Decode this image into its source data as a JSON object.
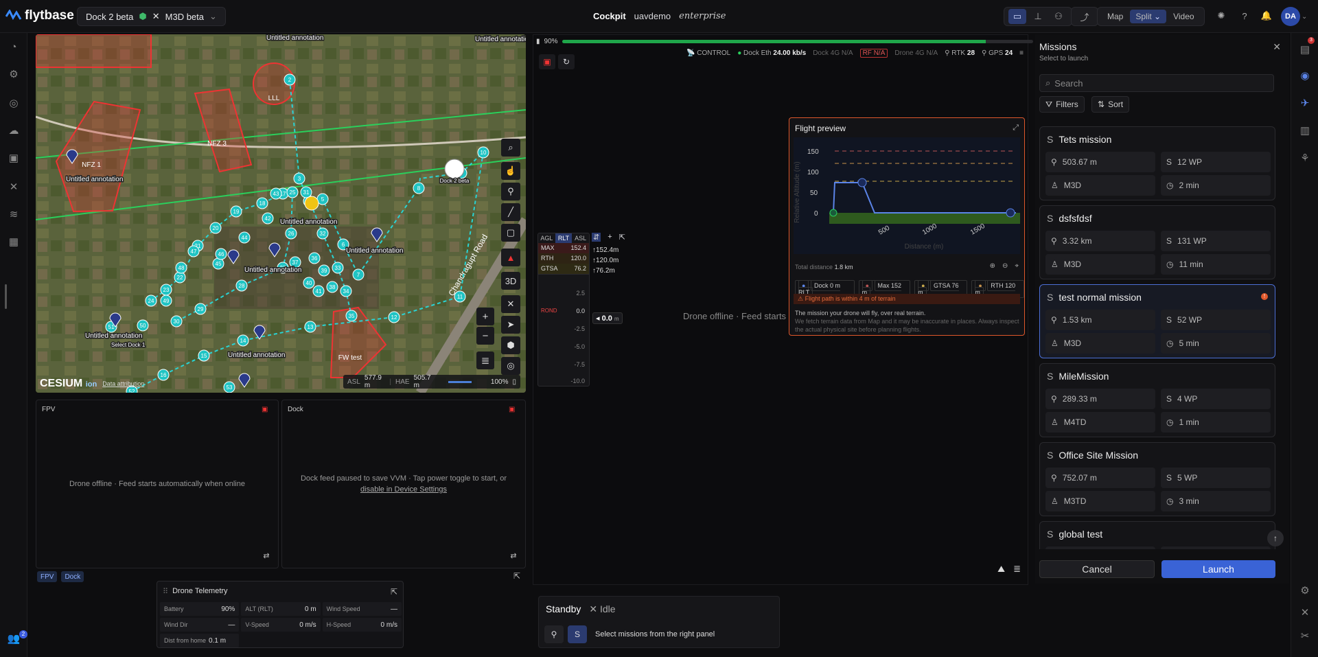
{
  "header": {
    "brand": "flytbase",
    "dock_name": "Dock 2 beta",
    "drone_name": "M3D beta",
    "title": "Cockpit",
    "org": "uavdemo",
    "tier": "enterprise",
    "views": [
      "Map",
      "Split",
      "Video"
    ],
    "active_view": "Split",
    "avatar": "DA"
  },
  "left_rail": {
    "badge": "2"
  },
  "map": {
    "annotations": [
      "Untitled annotation",
      "Untitled annotation",
      "Untitled annotation",
      "Untitled annotation",
      "Untitled annotation",
      "Untitled annotation",
      "Untitled annotation",
      "Untitled annotation",
      "Untitled annotation"
    ],
    "zones": [
      "NFZ 1",
      "NFZ 3",
      "LLL",
      "FW test"
    ],
    "road": "Chandragupt Road",
    "dock_label": "Dock 2 beta",
    "select_dock": "Select Dock 1",
    "waypoints": [
      "2",
      "3",
      "4",
      "5",
      "6",
      "7",
      "8",
      "9",
      "10",
      "11",
      "12",
      "13",
      "14",
      "15",
      "16",
      "17",
      "18",
      "19",
      "20",
      "21",
      "22",
      "23",
      "24",
      "25",
      "26",
      "27",
      "28",
      "29",
      "30",
      "31",
      "32",
      "33",
      "34",
      "35",
      "36",
      "37",
      "38",
      "39",
      "40",
      "41",
      "42",
      "43",
      "44",
      "45",
      "46",
      "47",
      "48",
      "49",
      "50",
      "51",
      "52",
      "53"
    ],
    "three_d": "3D",
    "cesium": "CESIUM",
    "ion": "ion",
    "attribution": "Data attribution",
    "asl_label": "ASL",
    "asl": "577.9 m",
    "hae_label": "HAE",
    "hae": "505.7 m",
    "zoom": "100%"
  },
  "feeds": {
    "fpv_title": "FPV",
    "fpv_msg": "Drone offline · Feed starts automatically when online",
    "dock_title": "Dock",
    "dock_msg": "Dock feed paused to save VVM · Tap power toggle to start, or",
    "dock_link": "disable in Device Settings",
    "chips": [
      "FPV",
      "Dock"
    ]
  },
  "telemetry": {
    "title": "Drone Telemetry",
    "cells": [
      {
        "label": "Battery",
        "value": "90%"
      },
      {
        "label": "ALT (RLT)",
        "value": "0 m"
      },
      {
        "label": "Wind Speed",
        "value": "—"
      },
      {
        "label": "Wind Dir",
        "value": "—"
      },
      {
        "label": "V-Speed",
        "value": "0 m/s"
      },
      {
        "label": "H-Speed",
        "value": "0 m/s"
      },
      {
        "label": "Dist from home",
        "value": "0.1 m"
      }
    ]
  },
  "status": {
    "battery": "90%",
    "battery_level": 0.9,
    "control": "CONTROL",
    "dock_eth_label": "Dock Eth",
    "dock_eth": "24.00 kb/s",
    "dock_4g": "Dock 4G",
    "na": "N/A",
    "rf": "RF",
    "drone_4g": "Drone 4G",
    "rtk_label": "RTK",
    "rtk": "28",
    "gps_label": "GPS",
    "gps": "24"
  },
  "altitude": {
    "tabs": [
      "AGL",
      "RLT",
      "ASL"
    ],
    "active": "RLT",
    "rows": [
      {
        "k": "MAX",
        "v": "152.4"
      },
      {
        "k": "RTH",
        "v": "120.0"
      },
      {
        "k": "GTSA",
        "v": "76.2"
      }
    ],
    "right": [
      "↑152.4m",
      "↑120.0m",
      "↑76.2m"
    ],
    "ticks": [
      "2.5",
      "0.0",
      "-2.5",
      "-5.0",
      "-7.5",
      "-10.0"
    ],
    "ground": "ROND",
    "current": "0.0"
  },
  "flight_preview": {
    "title": "Flight preview",
    "ylabel": "Relative Altitude (m)",
    "xlabel": "Distance (m)",
    "yticks": [
      "150",
      "100",
      "50",
      "0"
    ],
    "xticks": [
      "500",
      "1000",
      "1500"
    ],
    "total_label": "Total distance",
    "total": "1.8 km",
    "legend": [
      "Dock 0 m RLT",
      "Max 152 m",
      "GTSA 76 m",
      "RTH 120 m"
    ],
    "warning": "Flight path is within 4 m of terrain",
    "note": "The mission your drone will fly, over real terrain.",
    "note2": "We fetch terrain data from Map and it may be inaccurate in places. Always inspect the actual physical site before planning flights."
  },
  "center": {
    "offline": "Drone offline · Feed starts au",
    "standby": "Standby",
    "idle": "Idle",
    "select": "Select missions from the right panel"
  },
  "missions": {
    "title": "Missions",
    "subtitle": "Select to launch",
    "search_placeholder": "Search",
    "filters": "Filters",
    "sort": "Sort",
    "cancel": "Cancel",
    "launch": "Launch",
    "items": [
      {
        "name": "Tets mission",
        "distance": "503.67 m",
        "wp": "12 WP",
        "drone": "M3D",
        "time": "2 min"
      },
      {
        "name": "dsfsfdsf",
        "distance": "3.32 km",
        "wp": "131 WP",
        "drone": "M3D",
        "time": "11 min"
      },
      {
        "name": "test normal mission",
        "distance": "1.53 km",
        "wp": "52 WP",
        "drone": "M3D",
        "time": "5 min"
      },
      {
        "name": "MileMission",
        "distance": "289.33 m",
        "wp": "4 WP",
        "drone": "M4TD",
        "time": "1 min"
      },
      {
        "name": "Office Site Mission",
        "distance": "752.07 m",
        "wp": "5 WP",
        "drone": "M3TD",
        "time": "3 min"
      },
      {
        "name": "global test",
        "distance": "",
        "wp": "",
        "drone": "",
        "time": ""
      }
    ]
  },
  "right_rail": {
    "badge": "3"
  }
}
